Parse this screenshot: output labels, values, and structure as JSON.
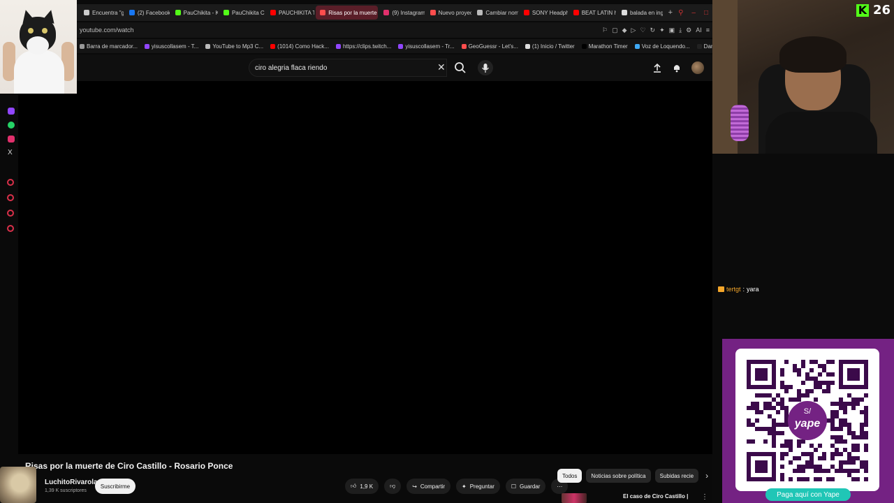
{
  "browser": {
    "tabs": [
      {
        "label": "Encuentra \"g",
        "color": "#cccccc"
      },
      {
        "label": "(2) Facebook",
        "color": "#1877f2"
      },
      {
        "label": "PauChikita - K",
        "color": "#53fc18"
      },
      {
        "label": "PauChikita Cl",
        "color": "#53fc18"
      },
      {
        "label": "PAUCHIKITA T",
        "color": "#ff0000"
      },
      {
        "label": "Risas por la muerte d",
        "color": "#ff4d4d"
      },
      {
        "label": "(9) Instagram",
        "color": "#e1306c"
      },
      {
        "label": "Nuevo proyec",
        "color": "#ff4d4d"
      },
      {
        "label": "Cambiar nom",
        "color": "#bbbbbb"
      },
      {
        "label": "SONY Headph",
        "color": "#ff0000"
      },
      {
        "label": "BEAT LATIN h",
        "color": "#ff0000"
      },
      {
        "label": "balada en ing",
        "color": "#dddddd"
      }
    ],
    "new_tab": "+",
    "url": "youtube.com/watch",
    "ai_label": "AI",
    "bookmarks": [
      {
        "label": "Barra de marcador...",
        "color": "#999999"
      },
      {
        "label": "yisuscollasem - T...",
        "color": "#9146ff"
      },
      {
        "label": "YouTube to Mp3 C...",
        "color": "#bbbbbb"
      },
      {
        "label": "(1014) Como Hack...",
        "color": "#ff0000"
      },
      {
        "label": "https://clips.twitch...",
        "color": "#9146ff"
      },
      {
        "label": "yisuscollasem - Tr...",
        "color": "#9146ff"
      },
      {
        "label": "GeoGuessr - Let's...",
        "color": "#ff4d4d"
      },
      {
        "label": "(1) Inicio / Twitter",
        "color": "#dddddd"
      },
      {
        "label": "Marathon Timer",
        "color": "#000000"
      },
      {
        "label": "Voz de Loquendo...",
        "color": "#3fa9f5"
      },
      {
        "label": "Dandadan, Capitul...",
        "color": "#222222"
      }
    ]
  },
  "youtube": {
    "search_query": "ciro alegria flaca riendo",
    "video_title": "Risas por la muerte de Ciro Castillo - Rosario Ponce",
    "channel_name": "LuchitoRivarola",
    "channel_subscribers": "1,39 K suscriptores",
    "subscribe_label": "Suscribirme",
    "like_count": "1,9 K",
    "share_label": "Compartir",
    "ask_label": "Preguntar",
    "save_label": "Guardar",
    "chips": [
      "Todos",
      "Noticias sobre política",
      "Subidas recie"
    ],
    "recommended_title": "El caso de Ciro Castillo |"
  },
  "stream": {
    "viewer_count": "26",
    "chat": [
      {
        "user": "tertgt",
        "message": "yara"
      }
    ],
    "yape_cta": "Paga aquí con Yape",
    "yape_wordmark": "yape",
    "yape_symbol": "S/"
  },
  "colors": {
    "kick_green": "#53fc18",
    "yape_purple": "#742283",
    "yape_teal": "#20c6b6",
    "youtube_red": "#ff0000"
  }
}
